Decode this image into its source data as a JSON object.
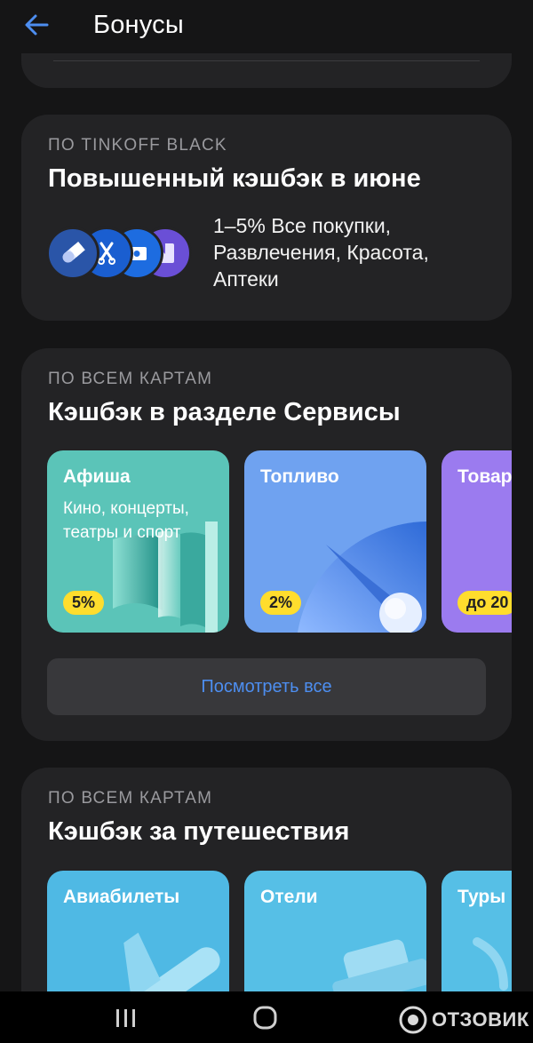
{
  "header": {
    "title": "Бонусы"
  },
  "black_card": {
    "eyebrow": "ПО TINKOFF BLACK",
    "title": "Повышенный кэшбэк в июне",
    "description": "1–5% Все покупки, Развлечения, Красота, Аптеки",
    "icons": [
      "pill-icon",
      "scissors-icon",
      "ticket-icon",
      "bookmark-icon"
    ]
  },
  "services_card": {
    "eyebrow": "ПО ВСЕМ КАРТАМ",
    "title": "Кэшбэк в разделе Сервисы",
    "tiles": [
      {
        "title": "Афиша",
        "subtitle": "Кино, концерты, театры и спорт",
        "badge": "5%",
        "color": "#5bc4b8"
      },
      {
        "title": "Топливо",
        "subtitle": "",
        "badge": "2%",
        "color": "#6fa2f0"
      },
      {
        "title": "Товар",
        "subtitle": "",
        "badge": "до 20",
        "color": "#9b7bef"
      }
    ],
    "see_all_label": "Посмотреть все"
  },
  "travel_card": {
    "eyebrow": "ПО ВСЕМ КАРТАМ",
    "title": "Кэшбэк за путешествия",
    "tiles": [
      {
        "title": "Авиабилеты",
        "color": "#4fb9e4"
      },
      {
        "title": "Отели",
        "color": "#56bfe6"
      },
      {
        "title": "Туры",
        "color": "#56bfe6"
      }
    ]
  },
  "watermark": {
    "text": "ОТЗОВИК"
  },
  "colors": {
    "accent": "#4d8ef0",
    "badge": "#ffdd2d",
    "card": "#232325",
    "background": "#151516"
  }
}
